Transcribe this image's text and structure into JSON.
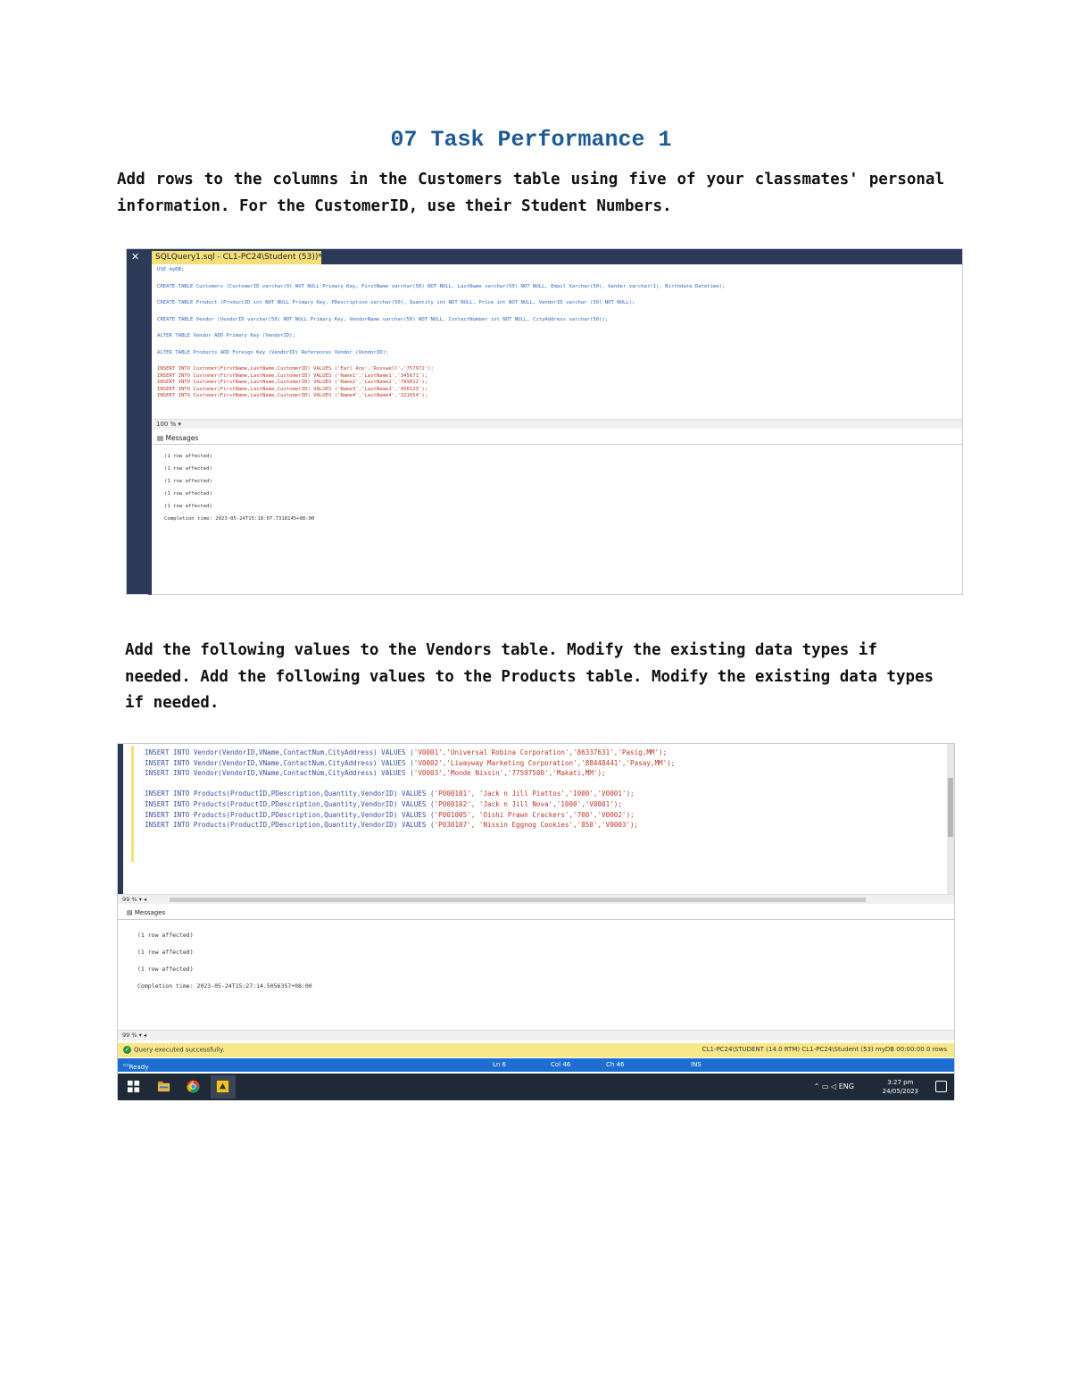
{
  "title": "07 Task Performance 1",
  "paragraph1": "Add rows to the columns in the Customers table using five of your classmates' personal information. For the CustomerID, use their Student Numbers.",
  "paragraph2": "Add the following values to the Vendors table. Modify the existing data types if needed. Add the following values to the Products table. Modify the existing data types if needed.",
  "screenshot1": {
    "tab_label": "SQLQuery1.sql - CL1-PC24\\Student (53))*",
    "code_lines": [
      "USE myDB;",
      "CREATE TABLE Customers (CustomerID varchar(9) NOT NULL Primary Key, FirstName varchar(50) NOT NULL, LastName varchar(50) NOT NULL, Email Varchar(50), Gender varchar(1), Birthdate Datetime);",
      "CREATE TABLE Product (ProductID int NOT NULL Primary Key, PDescription varchar(50), Quantity int NOT NULL, Price int NOT NULL, VendorID varchar (50) NOT NULL);",
      "CREATE TABLE Vendor (VendorID varchar(50) NOT NULL Primary Key, VendorName varchar(50) NOT NULL, ContactNumber int NOT NULL, CityAddress varchar(50));",
      "ALTER TABLE Vendor ADD Primary Key (VendorID);",
      "ALTER TABLE Products ADD Foreign Key (VendorID) References Vendor (VendorID);"
    ],
    "insert_lines": [
      "INSERT INTO Customer(FirstName,LastName,CustomerID) VALUES ('Earl Ace','Rosswell','757972');",
      "INSERT INTO Customer(FirstName,LastName,CustomerID) VALUES ('Name1','LastName1','345671');",
      "INSERT INTO Customer(FirstName,LastName,CustomerID) VALUES ('Name2','LastName2','789012');",
      "INSERT INTO Customer(FirstName,LastName,CustomerID) VALUES ('Name3','LastName3','456123');",
      "INSERT INTO Customer(FirstName,LastName,CustomerID) VALUES ('Name4','LastName4','321654');"
    ],
    "zoom": "100 %",
    "messages_tab": "Messages",
    "messages": [
      "(1 row affected)",
      "(1 row affected)",
      "(1 row affected)",
      "(1 row affected)",
      "(1 row affected)",
      "Completion time: 2023-05-24T15:18:07.7318145+08:00"
    ]
  },
  "screenshot2": {
    "vendor_lines": [
      {
        "prefix": "INSERT INTO Vendor(VendorID,VName,ContactNum,CityAddress) VALUES (",
        "values": "'V0001','Universal Robina Corporation','86337631','Pasig,MM');"
      },
      {
        "prefix": "INSERT INTO Vendor(VendorID,VName,ContactNum,CityAddress) VALUES (",
        "values": "'V0002','Liwayway Marketing Corporation','88448441','Pasay,MM');"
      },
      {
        "prefix": "INSERT INTO Vendor(VendorID,VName,ContactNum,CityAddress) VALUES (",
        "values": "'V0003','Monde Nissin','77597500','Makati,MM');"
      }
    ],
    "product_lines": [
      {
        "prefix": "INSERT INTO Products(ProductID,PDescription,Quantity,VendorID) VALUES (",
        "values": "'P000101', 'Jack n Jill Piattos','1000','V0001');"
      },
      {
        "prefix": "INSERT INTO Products(ProductID,PDescription,Quantity,VendorID) VALUES (",
        "values": "'P000102', 'Jack n Jill Nova','1000','V0001');"
      },
      {
        "prefix": "INSERT INTO Products(ProductID,PDescription,Quantity,VendorID) VALUES (",
        "values": "'P001005', 'Oishi Prawn Crackers','700','V0002');"
      },
      {
        "prefix": "INSERT INTO Products(ProductID,PDescription,Quantity,VendorID) VALUES (",
        "values": "'P030107', 'Nissin Eggnog Cookies','850','V0003');"
      }
    ],
    "zoom": "99 %",
    "messages_tab": "Messages",
    "messages": [
      "(1 row affected)",
      "(1 row affected)",
      "(1 row affected)",
      "Completion time: 2023-05-24T15:27:14.5056357+08:00"
    ],
    "status_left": "Query executed successfully.",
    "status_right": "CL1-PC24\\STUDENT (14.0 RTM)   CL1-PC24\\Student (53)   myDB   00:00:00   0 rows",
    "ready": "Ready",
    "ln": "Ln 6",
    "col": "Col 46",
    "ch": "Ch 46",
    "ins": "INS",
    "tray_lang": "ENG",
    "time": "3:27 pm",
    "date": "24/05/2023"
  }
}
